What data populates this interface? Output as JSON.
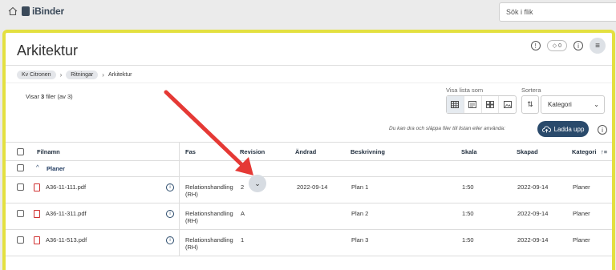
{
  "topbar": {
    "logo_text": "iBinder",
    "search_placeholder": "Sök i flik",
    "home_icon": "home-icon"
  },
  "page": {
    "title": "Arkitektur",
    "tag_count": "0",
    "menu_icon": "hamburger-icon"
  },
  "breadcrumb": [
    "Kv Citronen",
    "Ritningar",
    "Arkitektur"
  ],
  "files_count": {
    "prefix": "Visar ",
    "count": "3",
    "suffix": " filer (av 3)"
  },
  "view": {
    "label": "Visa lista som",
    "options": [
      "table-view-icon",
      "list-view-icon",
      "grid-view-icon",
      "image-view-icon"
    ]
  },
  "sort": {
    "label": "Sortera",
    "selected": "Kategori"
  },
  "upload": {
    "hint": "Du kan dra och släppa filer till listan eller använda:",
    "button_label": "Ladda upp"
  },
  "table": {
    "headers": {
      "filename": "Filnamn",
      "phase": "Fas",
      "revision": "Revision",
      "changed": "Ändrad",
      "description": "Beskrivning",
      "scale": "Skala",
      "created": "Skapad",
      "category": "Kategori"
    },
    "group": "Planer",
    "rows": [
      {
        "filename": "A36-11-111.pdf",
        "phase1": "Relationshandling",
        "phase2": "(RH)",
        "revision": "2",
        "changed": "2022-09-14",
        "description": "Plan 1",
        "scale": "1:50",
        "created": "2022-09-14",
        "category": "Planer"
      },
      {
        "filename": "A36-11-311.pdf",
        "phase1": "Relationshandling",
        "phase2": "(RH)",
        "revision": "A",
        "changed": "",
        "description": "Plan 2",
        "scale": "1:50",
        "created": "2022-09-14",
        "category": "Planer"
      },
      {
        "filename": "A36-11-513.pdf",
        "phase1": "Relationshandling",
        "phase2": "(RH)",
        "revision": "1",
        "changed": "",
        "description": "Plan 3",
        "scale": "1:50",
        "created": "2022-09-14",
        "category": "Planer"
      }
    ]
  },
  "colors": {
    "frame": "#e3e040",
    "arrow": "#e53935",
    "primary": "#2a4a6b"
  }
}
